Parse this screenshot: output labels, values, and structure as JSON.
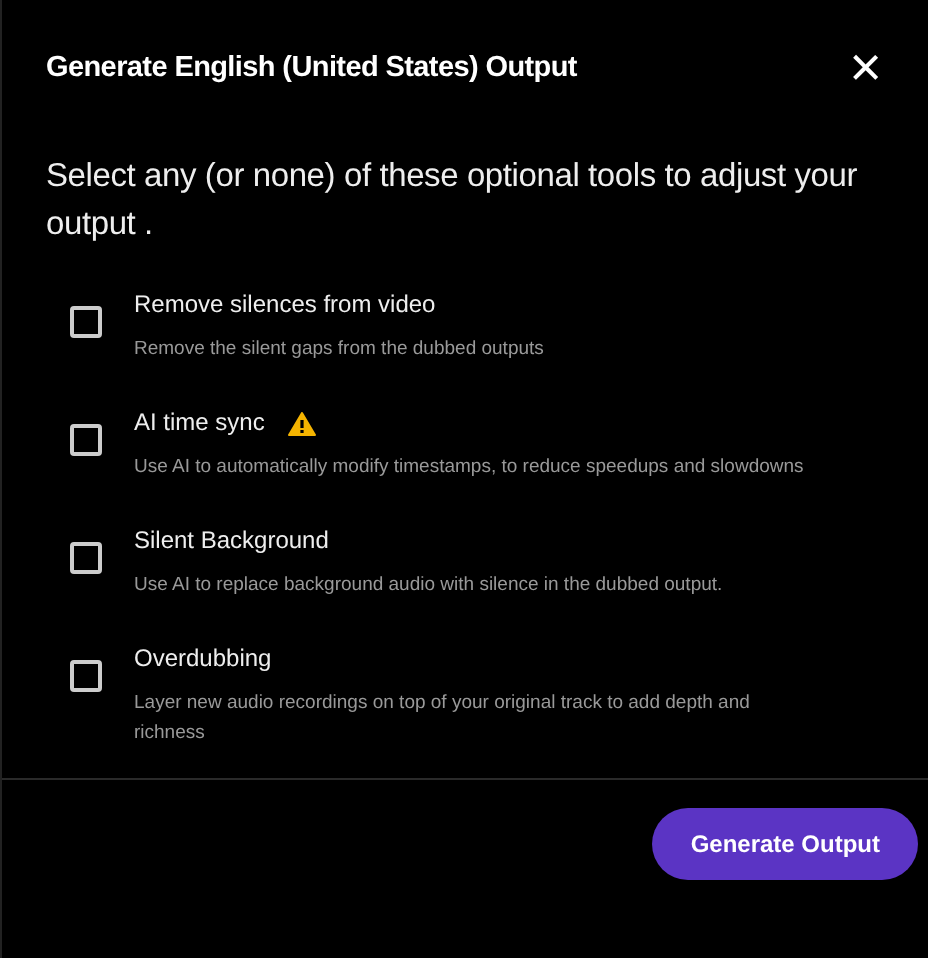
{
  "dialog": {
    "title": "Generate English (United States) Output",
    "close": "×"
  },
  "instruction": "Select any (or none) of these optional tools to adjust your output .",
  "options": [
    {
      "title": "Remove silences from video",
      "description": "Remove the silent gaps from the dubbed outputs",
      "checked": false,
      "warning": false
    },
    {
      "title": "AI time sync",
      "description": "Use AI to automatically modify timestamps, to reduce speedups and slowdowns",
      "checked": false,
      "warning": true
    },
    {
      "title": "Silent Background",
      "description": "Use AI to replace background audio with silence in the dubbed output.",
      "checked": false,
      "warning": false
    },
    {
      "title": "Overdubbing",
      "description": "Layer new audio recordings on top of your original track to add depth and richness",
      "checked": false,
      "warning": false
    }
  ],
  "buttons": [
    {
      "label": "Generate Output"
    }
  ]
}
